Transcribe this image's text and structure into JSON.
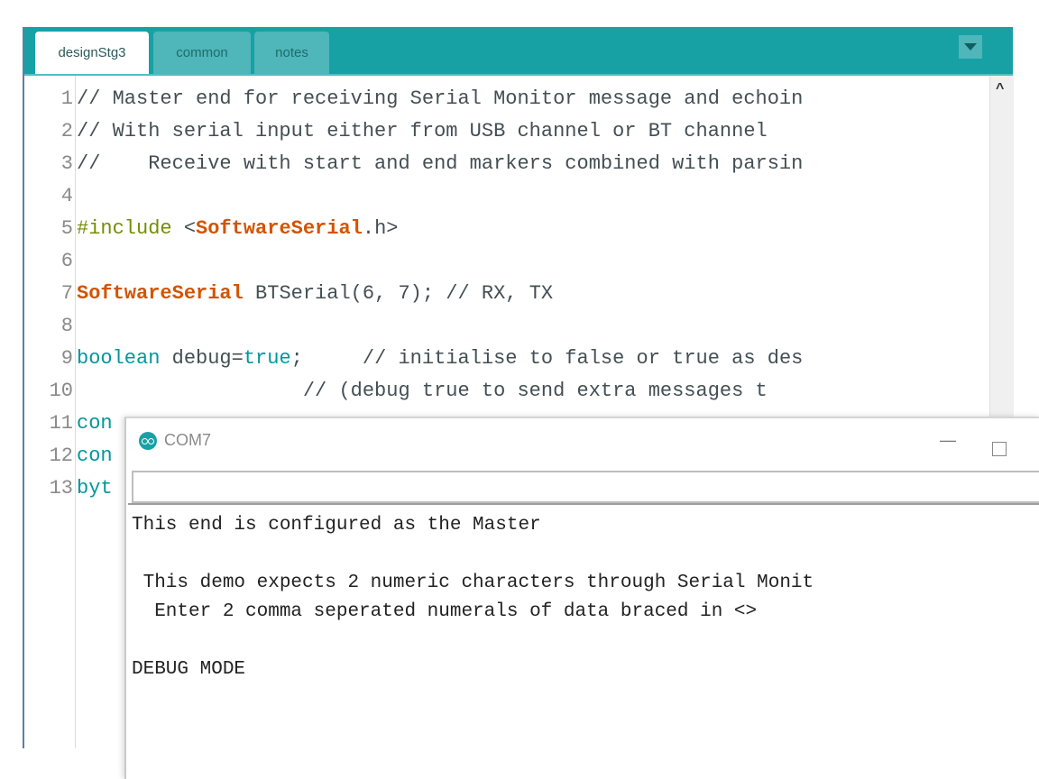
{
  "ide": {
    "tabs": [
      {
        "label": "designStg3",
        "active": true
      },
      {
        "label": "common",
        "active": false
      },
      {
        "label": "notes",
        "active": false
      }
    ],
    "tab_menu_icon": "dropdown-triangle-icon",
    "colors": {
      "tab_bar": "#17a1a5",
      "tab_inactive": "#4fb6b9",
      "keyword_orange": "#d35400",
      "keyword_teal": "#00979c",
      "keyword_green": "#728e00"
    },
    "lines": [
      {
        "n": "1",
        "parts": [
          {
            "t": "// Master end for receiving Serial Monitor message and echoin",
            "c": ""
          }
        ]
      },
      {
        "n": "2",
        "parts": [
          {
            "t": "// With serial input either from USB channel or BT channel",
            "c": ""
          }
        ]
      },
      {
        "n": "3",
        "parts": [
          {
            "t": "//    Receive with start and end markers combined with parsin",
            "c": ""
          }
        ]
      },
      {
        "n": "4",
        "parts": []
      },
      {
        "n": "5",
        "parts": [
          {
            "t": "#include ",
            "c": "kw-green"
          },
          {
            "t": "<",
            "c": ""
          },
          {
            "t": "SoftwareSerial",
            "c": "kw-orange"
          },
          {
            "t": ".h>",
            "c": ""
          }
        ]
      },
      {
        "n": "6",
        "parts": []
      },
      {
        "n": "7",
        "parts": [
          {
            "t": "SoftwareSerial",
            "c": "kw-orange"
          },
          {
            "t": " BTSerial(6, 7); // RX, TX",
            "c": ""
          }
        ]
      },
      {
        "n": "8",
        "parts": []
      },
      {
        "n": "9",
        "parts": [
          {
            "t": "boolean",
            "c": "kw-teal"
          },
          {
            "t": " debug=",
            "c": ""
          },
          {
            "t": "true",
            "c": "kw-teal"
          },
          {
            "t": ";     // initialise to false or true as des",
            "c": ""
          }
        ]
      },
      {
        "n": "10",
        "parts": [
          {
            "t": "                   // (debug true to send extra messages t",
            "c": ""
          }
        ]
      },
      {
        "n": "11",
        "parts": [
          {
            "t": "con",
            "c": "kw-teal"
          }
        ]
      },
      {
        "n": "12",
        "parts": [
          {
            "t": "con",
            "c": "kw-teal"
          }
        ]
      },
      {
        "n": "13",
        "parts": [
          {
            "t": "byt",
            "c": "kw-teal"
          }
        ]
      }
    ],
    "scroll_up_glyph": "^"
  },
  "serial_monitor": {
    "title": "COM7",
    "icon": "arduino-logo-icon",
    "minimize_glyph": "—",
    "input_value": "",
    "output_lines": [
      "This end is configured as the Master",
      "",
      " This demo expects 2 numeric characters through Serial Monit",
      "  Enter 2 comma seperated numerals of data braced in <>",
      "",
      "DEBUG MODE"
    ]
  }
}
